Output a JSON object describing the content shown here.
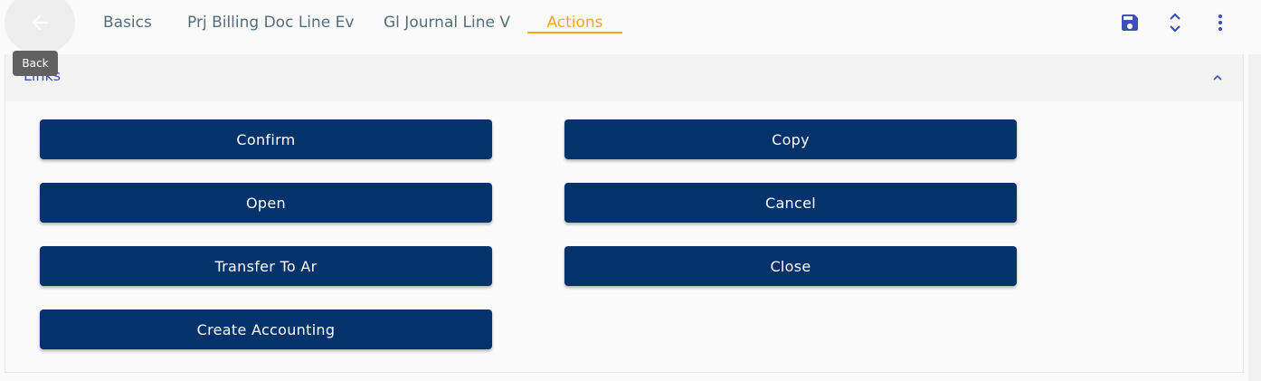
{
  "tabs": [
    {
      "label": "Basics"
    },
    {
      "label": "Prj Billing Doc Line Ev"
    },
    {
      "label": "Gl Journal Line V"
    },
    {
      "label": "Actions"
    }
  ],
  "back": {
    "tooltip": "Back",
    "icon": "arrow-left-icon"
  },
  "toolbar": {
    "icons": [
      "save-icon",
      "unfold-icon",
      "more-vert-icon"
    ],
    "accent": "#3f51b5"
  },
  "panel": {
    "title": "Links"
  },
  "actions": {
    "left": [
      {
        "label": "Confirm"
      },
      {
        "label": "Open"
      },
      {
        "label": "Transfer To Ar"
      },
      {
        "label": "Create Accounting"
      }
    ],
    "right": [
      {
        "label": "Copy"
      },
      {
        "label": "Cancel"
      },
      {
        "label": "Close"
      }
    ]
  },
  "colors": {
    "button_bg": "#04326b",
    "active_tab": "#f5a623",
    "tab_text": "#546e7a",
    "link_blue": "#3f51b5"
  }
}
